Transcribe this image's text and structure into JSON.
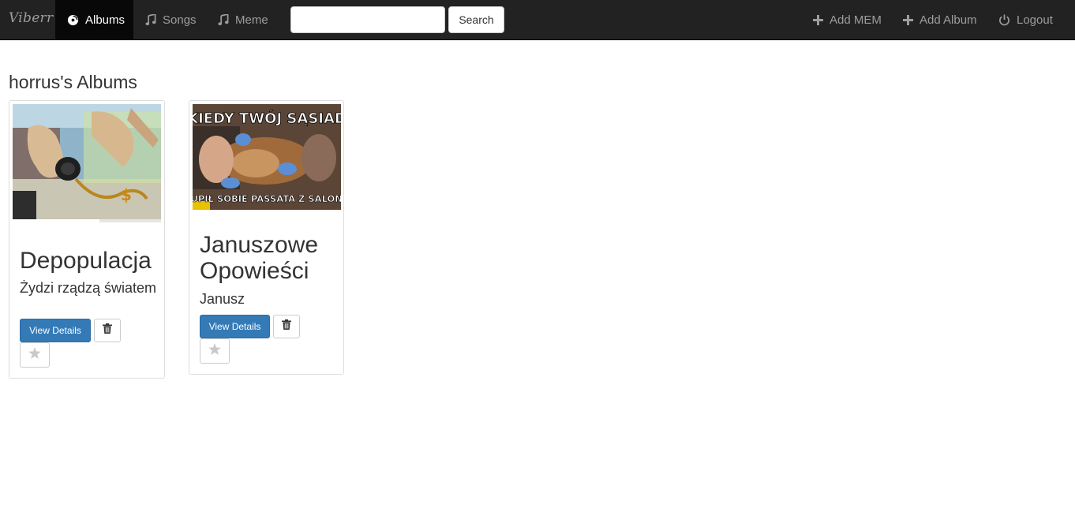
{
  "navbar": {
    "brand": "Viberr",
    "items": [
      {
        "label": "Albums",
        "icon": "disc-icon",
        "active": true
      },
      {
        "label": "Songs",
        "icon": "music-note-icon",
        "active": false
      },
      {
        "label": "Meme",
        "icon": "music-note-icon",
        "active": false
      }
    ],
    "search": {
      "value": "",
      "placeholder": "",
      "button_label": "Search"
    },
    "right_items": [
      {
        "label": "Add MEM",
        "icon": "plus-icon"
      },
      {
        "label": "Add Album",
        "icon": "plus-icon"
      },
      {
        "label": "Logout",
        "icon": "power-icon"
      }
    ]
  },
  "page": {
    "heading": "horrus's Albums"
  },
  "albums": [
    {
      "title": "Depopulacja",
      "artist": "Żydzi rządzą światem",
      "details_label": "View Details",
      "delete_icon": "trash-icon",
      "favorite_icon": "star-icon"
    },
    {
      "title": "Januszowe Opowieści",
      "artist": "Janusz",
      "image_text_top": "KIEDY TWÓJ SĄSIAD",
      "image_text_bottom": "KUPIŁ SOBIE PASSATA Z SALONU",
      "details_label": "View Details",
      "delete_icon": "trash-icon",
      "favorite_icon": "star-icon"
    }
  ],
  "colors": {
    "navbar_bg": "#222222",
    "navbar_active": "#080808",
    "primary": "#337ab7"
  }
}
